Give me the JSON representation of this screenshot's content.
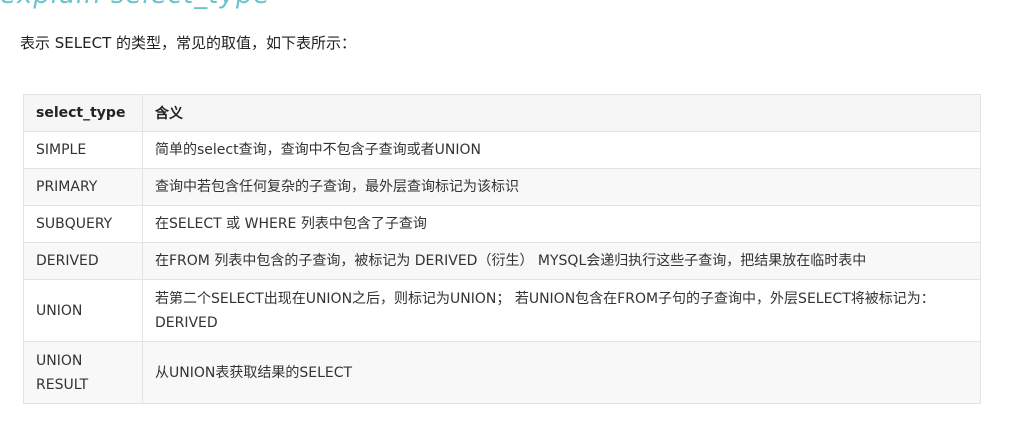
{
  "heading": {
    "text": "explain select_type"
  },
  "intro": {
    "text": "表示 SELECT 的类型，常见的取值，如下表所示："
  },
  "table": {
    "headers": [
      "select_type",
      "含义"
    ],
    "rows": [
      [
        "SIMPLE",
        "简单的select查询，查询中不包含子查询或者UNION"
      ],
      [
        "PRIMARY",
        "查询中若包含任何复杂的子查询，最外层查询标记为该标识"
      ],
      [
        "SUBQUERY",
        "在SELECT 或 WHERE 列表中包含了子查询"
      ],
      [
        "DERIVED",
        "在FROM 列表中包含的子查询，被标记为 DERIVED（衍生） MYSQL会递归执行这些子查询，把结果放在临时表中"
      ],
      [
        "UNION",
        "若第二个SELECT出现在UNION之后，则标记为UNION； 若UNION包含在FROM子句的子查询中，外层SELECT将被标记为： DERIVED"
      ],
      [
        "UNION RESULT",
        "从UNION表获取结果的SELECT"
      ]
    ]
  }
}
